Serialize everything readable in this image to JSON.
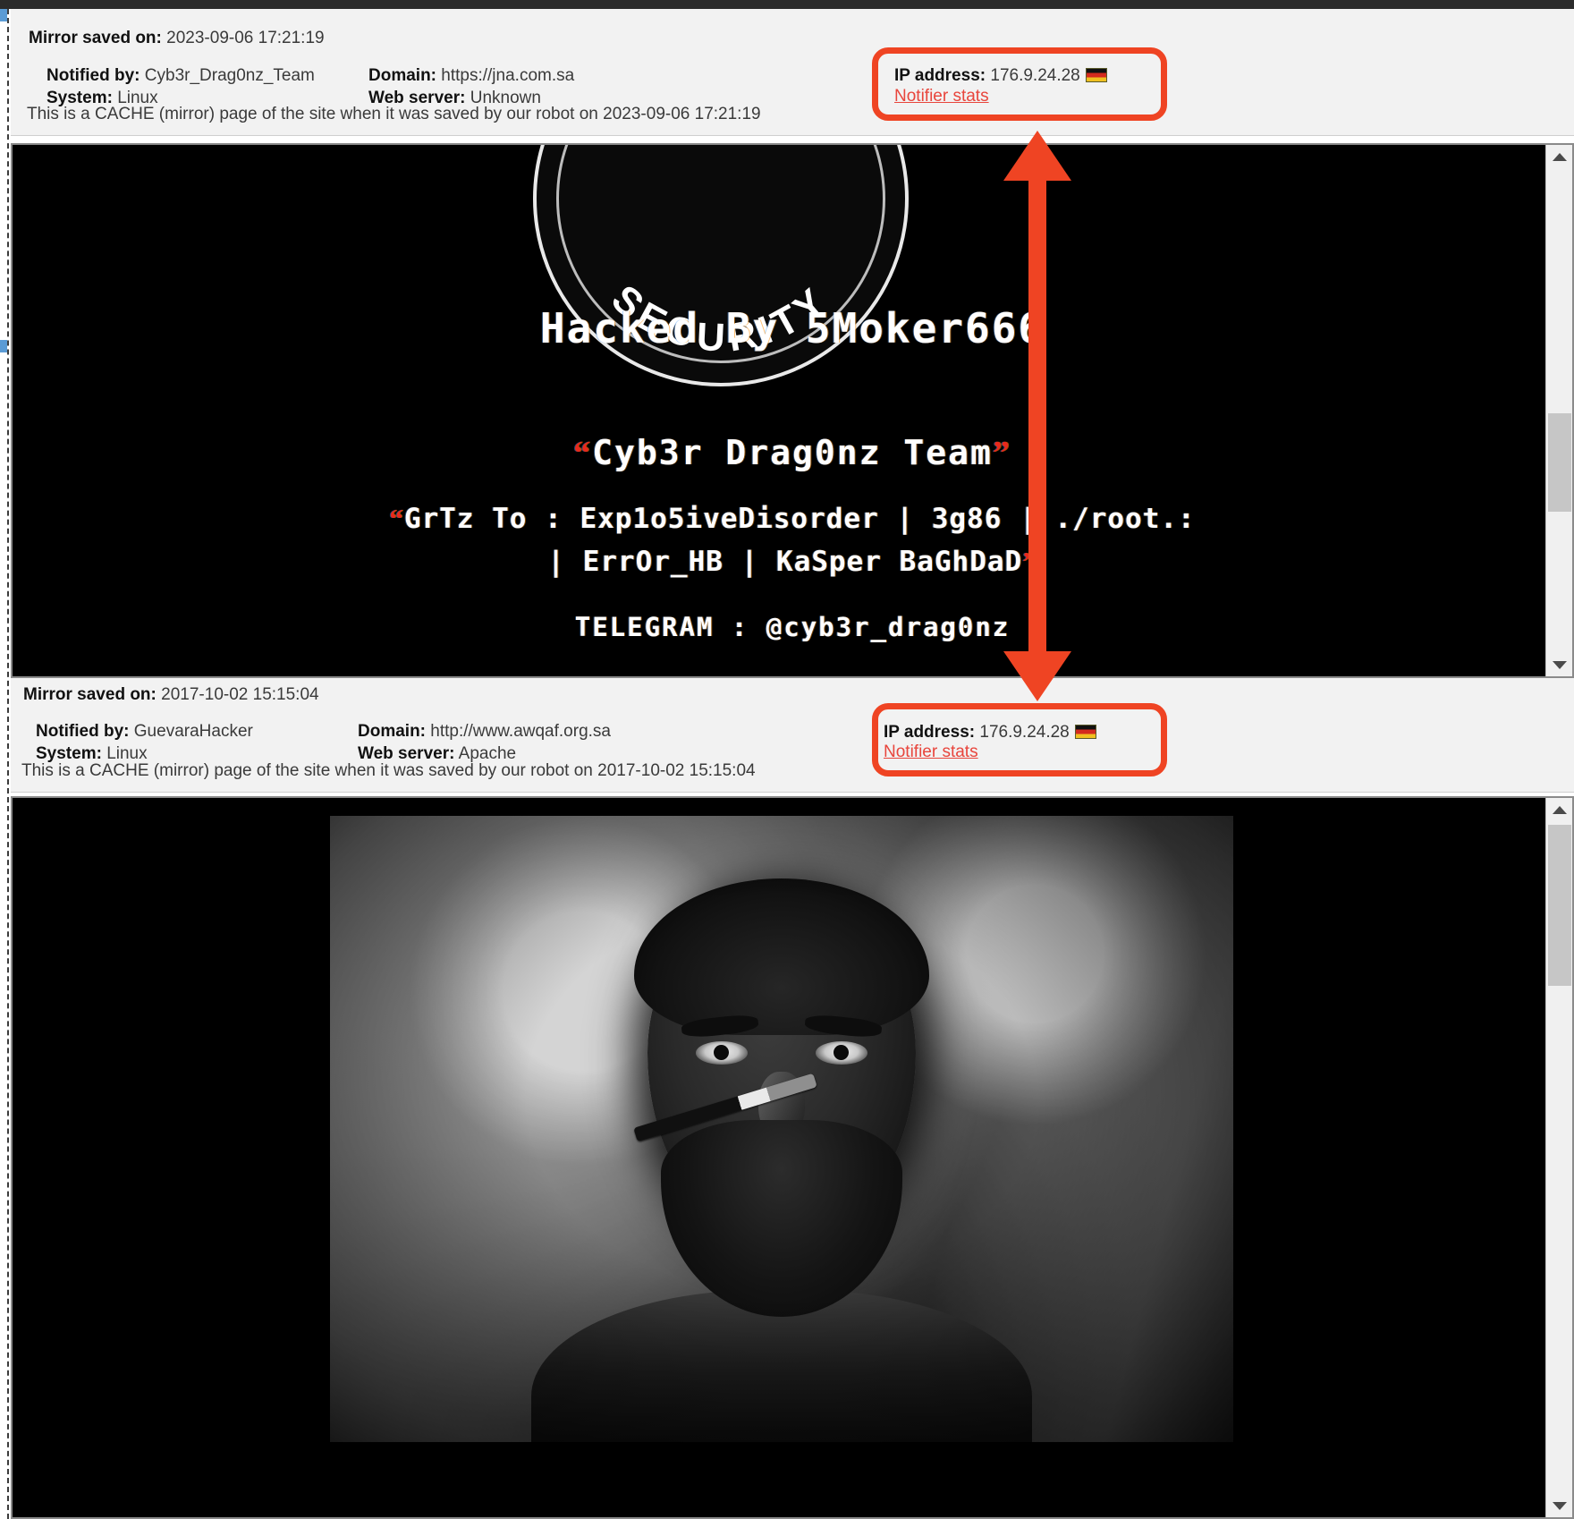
{
  "mirrors": [
    {
      "saved_label": "Mirror saved on:",
      "saved_value": "2023-09-06 17:21:19",
      "notified_by_label": "Notified by:",
      "notified_by_value": "Cyb3r_Drag0nz_Team",
      "system_label": "System:",
      "system_value": "Linux",
      "domain_label": "Domain:",
      "domain_value": "https://jna.com.sa",
      "webserver_label": "Web server:",
      "webserver_value": "Unknown",
      "cache_note_prefix": "This is a CACHE (mirror) page of the site when it was saved by our robot on ",
      "cache_note_date": "2023-09-06 17:21:19",
      "ip_label": "IP address:",
      "ip_value": "176.9.24.28",
      "flag_icon": "germany-flag-icon",
      "notifier_stats_link": "Notifier stats"
    },
    {
      "saved_label": "Mirror saved on:",
      "saved_value": "2017-10-02 15:15:04",
      "notified_by_label": "Notified by:",
      "notified_by_value": "GuevaraHacker",
      "system_label": "System:",
      "system_value": "Linux",
      "domain_label": "Domain:",
      "domain_value": "http://www.awqaf.org.sa",
      "webserver_label": "Web server:",
      "webserver_value": "Apache",
      "cache_note_prefix": "This is a CACHE (mirror) page of the site when it was saved by our robot on ",
      "cache_note_date": "2017-10-02 15:15:04",
      "ip_label": "IP address:",
      "ip_value": "176.9.24.28",
      "flag_icon": "germany-flag-icon",
      "notifier_stats_link": "Notifier stats"
    }
  ],
  "deface_page_1": {
    "logo_arc_text": "SECURITY",
    "headline": "Hacked By 5Moker666",
    "team_quote_open": "“",
    "team_name": "Cyb3r Drag0nz Team",
    "team_quote_close": "”",
    "greetz_quote_open": "“",
    "greetz_line_1": "GrTz To : Exp1o5iveDisorder | 3g86 | ./root.:",
    "greetz_line_2": "| ErrOr_HB | KaSper BaGhDaD",
    "greetz_quote_close": "”",
    "telegram": "TELEGRAM : @cyb3r_drag0nz"
  },
  "deface_page_2": {
    "image_alt": "che-guevara-photo"
  },
  "colors": {
    "annotation_red": "#ef4423",
    "link_red": "#e8453c",
    "panel_bg": "#f2f2f2",
    "deface_bg": "#000000"
  },
  "scrollbars": {
    "up_arrow_icon": "scroll-up-arrow-icon",
    "down_arrow_icon": "scroll-down-arrow-icon"
  },
  "annotation": {
    "name": "double-headed-arrow",
    "description": "arrow linking the two IP address boxes"
  }
}
